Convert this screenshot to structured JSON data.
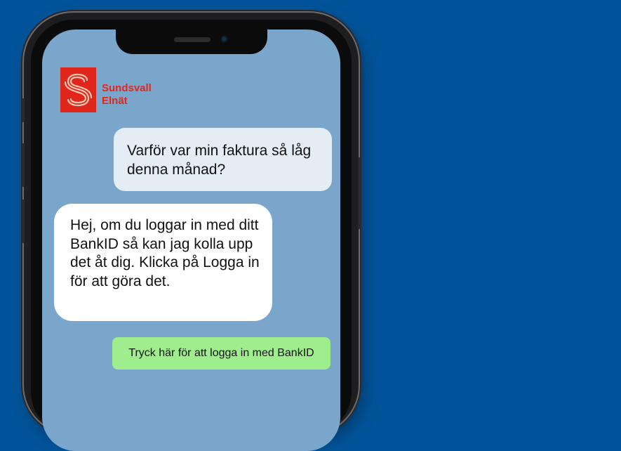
{
  "brand": {
    "line1": "Sundsvall",
    "line2": "Elnät",
    "color": "#e1261c",
    "icon": "sundsvall-elnat-logo-icon"
  },
  "chat": {
    "user_message": "Varför var min faktura så låg denna månad?",
    "bot_message": "Hej, om du loggar in med ditt BankID så kan jag kolla upp det åt dig. Klicka på Logga in för att göra det.",
    "login_button": "Tryck här för att logga in med BankID"
  },
  "colors": {
    "background": "#02549a",
    "screen": "#7aa6cc",
    "user_bubble": "#e4ecf4",
    "bot_bubble": "#ffffff",
    "button": "#9fee8e"
  }
}
